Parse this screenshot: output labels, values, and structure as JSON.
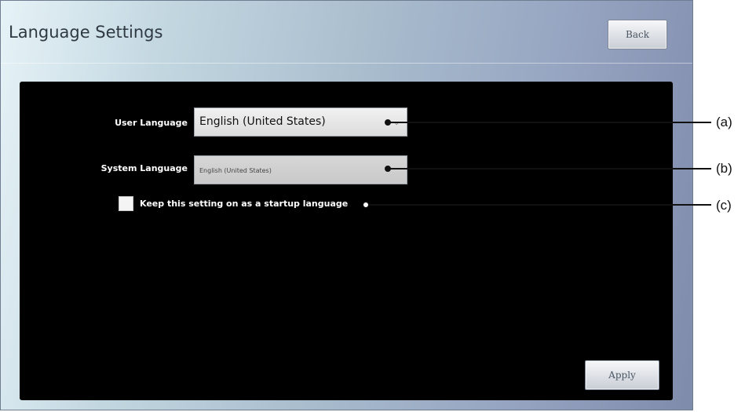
{
  "window": {
    "title": "Language Settings",
    "back_label": "Back"
  },
  "form": {
    "user_language": {
      "label": "User Language",
      "value": "English (United States)"
    },
    "system_language": {
      "label": "System Language",
      "value": "English (United States)"
    },
    "startup_checkbox": {
      "label": "Keep this setting on as a startup language",
      "checked": false
    },
    "apply_label": "Apply"
  },
  "dropdown_icon": "chevron-down-icon",
  "callouts": [
    "(a)",
    "(b)",
    "(c)"
  ]
}
